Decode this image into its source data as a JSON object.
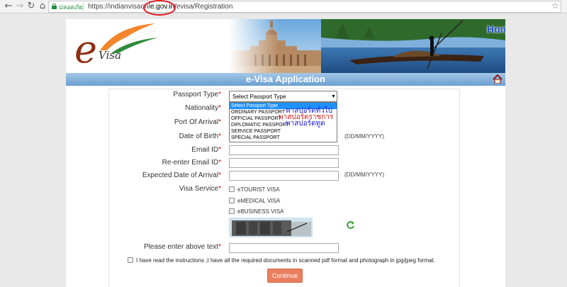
{
  "browser": {
    "nav_back": "←",
    "nav_forward": "→",
    "nav_reload": "↻",
    "nav_home": "⌂",
    "secure_label": "ปลอดภัย",
    "url_prefix": "https://indianvisaonl",
    "url_domain": "e.gov.in/",
    "url_suffix": "e",
    "url_path": "visa/Registration",
    "bookmark_icon": "☆"
  },
  "header": {
    "logo_e": "e",
    "logo_visa": "Visa",
    "watermark": "Honeynut"
  },
  "titlebar": {
    "title": "e-Visa Application"
  },
  "form": {
    "passport_type": {
      "label": "Passport Type",
      "required": "*",
      "value": "Select Passport Type",
      "options": [
        "Select Passport Type",
        "ORDINARY PASSPORT",
        "OFFICIAL PASSPORT",
        "DIPLOMATIC PASSPORT",
        "SERVICE PASSPORT",
        "SPECIAL PASSPORT"
      ]
    },
    "nationality": {
      "label": "Nationality",
      "required": "*"
    },
    "port_of_arrival": {
      "label": "Port Of Arrival",
      "required": "*"
    },
    "date_of_birth": {
      "label": "Date of Birth",
      "required": "*",
      "hint": "(DD/MM/YYYY)"
    },
    "email": {
      "label": "Email ID",
      "required": "*"
    },
    "reemail": {
      "label": "Re-enter Email ID",
      "required": "*"
    },
    "arrival_date": {
      "label": "Expected Date of Arrival",
      "required": "*",
      "hint": "(DD/MM/YYYY)"
    },
    "visa_service": {
      "label": "Visa Service",
      "required": "*",
      "options": [
        "eTOURIST VISA",
        "eMEDICAL VISA",
        "eBUSINESS VISA"
      ]
    },
    "captcha": {
      "label": "Please enter above text",
      "required": "*"
    },
    "agreement": "I have read the instructions ,I have all the required documents in scanned pdf format and photograph in jpg/jpeg format.",
    "continue_label": "Continue"
  },
  "annotations": {
    "ordinary": "พาสปอร์ตทั่วไป",
    "official": "พาสปอร์ตราชการ",
    "diplomatic": "พาสปอร์ตทูต"
  },
  "colors": {
    "accent_blue": "#6a9fd0",
    "selected_option": "#1e90ff",
    "continue_button": "#ea7f5f",
    "required_star": "#d40000",
    "highlight_circle": "#e0141b",
    "thai_blue": "#1a1adf",
    "thai_red": "#d21a1a"
  }
}
